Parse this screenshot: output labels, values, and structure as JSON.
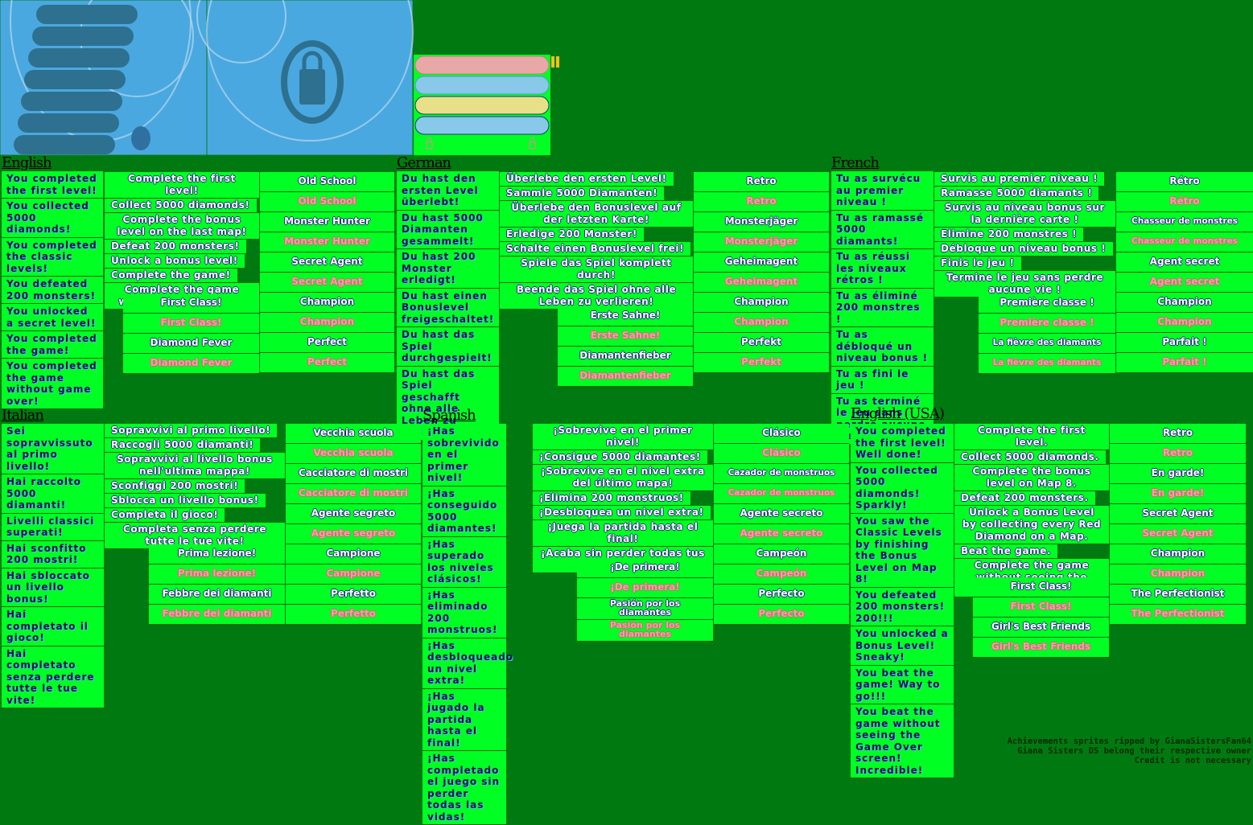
{
  "colors": {
    "background": "#007a10",
    "box": "#00ff22",
    "panel": "#4aa8e0",
    "unlocked_text": "#ffffff",
    "locked_text": "#f3a0a0"
  },
  "sprites": {
    "panel_list_icon": "achievement-list-icon",
    "panel_lock_icon": "padlock-icon",
    "bars": [
      "#e8a8a8",
      "#88c8e8",
      "#e8e088",
      "#88c8e8"
    ],
    "small_icons": [
      "lock-icon",
      "lock-icon"
    ]
  },
  "sections": [
    {
      "language": "English",
      "descriptions": [
        "You completed the first level!",
        "You collected 5000 diamonds!",
        "You completed the classic levels!",
        "You defeated 200 monsters!",
        "You unlocked a secret level!",
        "You completed the game!",
        "You completed the game without game over!"
      ],
      "tasks": [
        "Complete the first level!",
        "Collect 5000 diamonds!",
        "Complete the bonus level on the last map!",
        "Defeat 200 monsters!",
        "Unlock a bonus level!",
        "Complete the game!",
        "Complete the game without a game over!"
      ],
      "titles_a": [
        "First Class!",
        "Diamond Fever"
      ],
      "titles_b": [
        "Old School",
        "Monster Hunter",
        "Secret Agent",
        "Champion",
        "Perfect"
      ]
    },
    {
      "language": "German",
      "descriptions": [
        "Du hast den ersten Level überlebt!",
        "Du hast 5000 Diamanten gesammelt!",
        "Du hast 200 Monster erledigt!",
        "Du hast einen Bonuslevel freigeschaltet!",
        "Du hast das Spiel durchgespielt!",
        "Du hast das Spiel geschafft ohne alle Leben zu verlieren!"
      ],
      "tasks": [
        "Überlebe den ersten Level!",
        "Sammle 5000 Diamanten!",
        "Überlebe den Bonuslevel auf der letzten Karte!",
        "Erledige 200 Monster!",
        "Schalte einen Bonuslevel frei!",
        "Spiele das Spiel komplett durch!",
        "Beende das Spiel ohne alle Leben zu verlieren!"
      ],
      "titles_a": [
        "Erste Sahne!",
        "Diamantenfieber"
      ],
      "titles_b": [
        "Retro",
        "Monsterjäger",
        "Geheimagent",
        "Champion",
        "Perfekt"
      ]
    },
    {
      "language": "French",
      "descriptions": [
        "Tu as survécu au premier niveau !",
        "Tu as ramassé 5000 diamants!",
        "Tu as réussi les niveaux rétros !",
        "Tu as éliminé 200 monstres !",
        "Tu as débloqué un niveau bonus !",
        "Tu as fini le jeu !",
        "Tu as terminé le jeu sans perdre aucune vie !"
      ],
      "tasks": [
        "Survis au premier niveau !",
        "Ramasse 5000 diamants !",
        "Survis au niveau bonus sur la dernière carte !",
        "Elimine 200 monstres !",
        "Débloque un niveau bonus !",
        "Finis le jeu !",
        "Termine le jeu sans perdre aucune vie !"
      ],
      "titles_a": [
        "Première classe !",
        "La fièvre des diamants"
      ],
      "titles_b": [
        "Rétro",
        "Chasseur de monstres",
        "Agent secret",
        "Champion",
        "Parfait !"
      ]
    },
    {
      "language": "Italian",
      "descriptions": [
        "Sei sopravvissuto al primo livello!",
        "Hai raccolto 5000 diamanti!",
        "Livelli classici superati!",
        "Hai sconfitto 200 mostri!",
        "Hai sbloccato un livello bonus!",
        "Hai completato il gioco!",
        "Hai completato senza perdere tutte le tue vite!"
      ],
      "tasks": [
        "Sopravvivi al primo livello!",
        "Raccogli 5000 diamanti!",
        "Sopravvivi al livello bonus nell'ultima mappa!",
        "Sconfiggi 200 mostri!",
        "Sblocca un livello bonus!",
        "Completa il gioco!",
        "Completa senza perdere tutte le tue vite!"
      ],
      "titles_a": [
        "Prima lezione!",
        "Febbre dei diamanti"
      ],
      "titles_b": [
        "Vecchia scuola",
        "Cacciatore di mostri",
        "Agente segreto",
        "Campione",
        "Perfetto"
      ]
    },
    {
      "language": "Spanish",
      "descriptions": [
        "¡Has sobrevivido en el primer nivel!",
        "¡Has conseguido 5000 diamantes!",
        "¡Has superado los niveles clásicos!",
        "¡Has eliminado 200 monstruos!",
        "¡Has desbloqueado un nivel extra!",
        "¡Has jugado la partida hasta el final!",
        "¡Has completado el juego sin perder todas las vidas!"
      ],
      "tasks": [
        "¡Sobrevive en el primer nivel!",
        "¡Consigue 5000 diamantes!",
        "¡Sobrevive en el nivel extra del último mapa!",
        "¡Elimina 200 monstruos!",
        "¡Desbloquea un nivel extra!",
        "¡Juega la partida hasta el final!",
        "¡Acaba sin perder todas tus vidas!"
      ],
      "titles_a": [
        "¡De primera!",
        "Pasión por los diamantes"
      ],
      "titles_b": [
        "Clásico",
        "Cazador de monstruos",
        "Agente secreto",
        "Campeón",
        "Perfecto"
      ]
    },
    {
      "language": "English (USA)",
      "descriptions": [
        "You completed the first level! Well done!",
        "You collected 5000 diamonds! Sparkly!",
        "You saw the Classic Levels by finishing the Bonus Level on Map 8!",
        "You defeated 200 monsters! 200!!!",
        "You unlocked a Bonus Level! Sneaky!",
        "You beat the game! Way to go!!!",
        "You beat the game without seeing the Game Over screen! Incredible!"
      ],
      "tasks": [
        "Complete the first level.",
        "Collect 5000 diamonds.",
        "Complete the bonus level on Map 8.",
        "Defeat 200 monsters.",
        "Unlock a Bonus Level by collecting every Red Diamond on a Map.",
        "Beat the game.",
        "Complete the game without seeing the Game Over screen."
      ],
      "titles_a": [
        "First Class!",
        "Girl's Best Friends"
      ],
      "titles_b": [
        "Retro",
        "En garde!",
        "Secret Agent",
        "Champion",
        "The Perfectionist"
      ]
    }
  ],
  "credits": [
    "Achievements sprites ripped by GianaSistersFan64",
    "Giana Sisters DS  belong their respective owner",
    "Credit is not necessary"
  ]
}
